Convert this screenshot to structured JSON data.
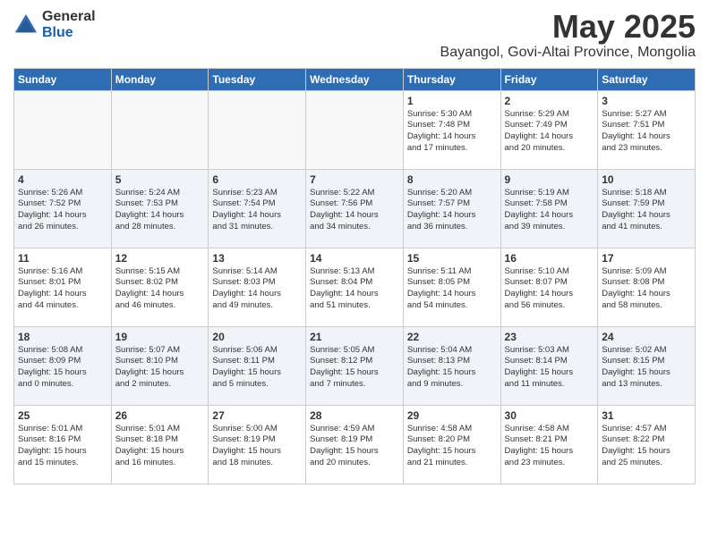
{
  "logo": {
    "general": "General",
    "blue": "Blue"
  },
  "title": "May 2025",
  "location": "Bayangol, Govi-Altai Province, Mongolia",
  "days_header": [
    "Sunday",
    "Monday",
    "Tuesday",
    "Wednesday",
    "Thursday",
    "Friday",
    "Saturday"
  ],
  "weeks": [
    {
      "row_class": "row-odd",
      "days": [
        {
          "num": "",
          "info": ""
        },
        {
          "num": "",
          "info": ""
        },
        {
          "num": "",
          "info": ""
        },
        {
          "num": "",
          "info": ""
        },
        {
          "num": "1",
          "info": "Sunrise: 5:30 AM\nSunset: 7:48 PM\nDaylight: 14 hours\nand 17 minutes."
        },
        {
          "num": "2",
          "info": "Sunrise: 5:29 AM\nSunset: 7:49 PM\nDaylight: 14 hours\nand 20 minutes."
        },
        {
          "num": "3",
          "info": "Sunrise: 5:27 AM\nSunset: 7:51 PM\nDaylight: 14 hours\nand 23 minutes."
        }
      ]
    },
    {
      "row_class": "row-even",
      "days": [
        {
          "num": "4",
          "info": "Sunrise: 5:26 AM\nSunset: 7:52 PM\nDaylight: 14 hours\nand 26 minutes."
        },
        {
          "num": "5",
          "info": "Sunrise: 5:24 AM\nSunset: 7:53 PM\nDaylight: 14 hours\nand 28 minutes."
        },
        {
          "num": "6",
          "info": "Sunrise: 5:23 AM\nSunset: 7:54 PM\nDaylight: 14 hours\nand 31 minutes."
        },
        {
          "num": "7",
          "info": "Sunrise: 5:22 AM\nSunset: 7:56 PM\nDaylight: 14 hours\nand 34 minutes."
        },
        {
          "num": "8",
          "info": "Sunrise: 5:20 AM\nSunset: 7:57 PM\nDaylight: 14 hours\nand 36 minutes."
        },
        {
          "num": "9",
          "info": "Sunrise: 5:19 AM\nSunset: 7:58 PM\nDaylight: 14 hours\nand 39 minutes."
        },
        {
          "num": "10",
          "info": "Sunrise: 5:18 AM\nSunset: 7:59 PM\nDaylight: 14 hours\nand 41 minutes."
        }
      ]
    },
    {
      "row_class": "row-odd",
      "days": [
        {
          "num": "11",
          "info": "Sunrise: 5:16 AM\nSunset: 8:01 PM\nDaylight: 14 hours\nand 44 minutes."
        },
        {
          "num": "12",
          "info": "Sunrise: 5:15 AM\nSunset: 8:02 PM\nDaylight: 14 hours\nand 46 minutes."
        },
        {
          "num": "13",
          "info": "Sunrise: 5:14 AM\nSunset: 8:03 PM\nDaylight: 14 hours\nand 49 minutes."
        },
        {
          "num": "14",
          "info": "Sunrise: 5:13 AM\nSunset: 8:04 PM\nDaylight: 14 hours\nand 51 minutes."
        },
        {
          "num": "15",
          "info": "Sunrise: 5:11 AM\nSunset: 8:05 PM\nDaylight: 14 hours\nand 54 minutes."
        },
        {
          "num": "16",
          "info": "Sunrise: 5:10 AM\nSunset: 8:07 PM\nDaylight: 14 hours\nand 56 minutes."
        },
        {
          "num": "17",
          "info": "Sunrise: 5:09 AM\nSunset: 8:08 PM\nDaylight: 14 hours\nand 58 minutes."
        }
      ]
    },
    {
      "row_class": "row-even",
      "days": [
        {
          "num": "18",
          "info": "Sunrise: 5:08 AM\nSunset: 8:09 PM\nDaylight: 15 hours\nand 0 minutes."
        },
        {
          "num": "19",
          "info": "Sunrise: 5:07 AM\nSunset: 8:10 PM\nDaylight: 15 hours\nand 2 minutes."
        },
        {
          "num": "20",
          "info": "Sunrise: 5:06 AM\nSunset: 8:11 PM\nDaylight: 15 hours\nand 5 minutes."
        },
        {
          "num": "21",
          "info": "Sunrise: 5:05 AM\nSunset: 8:12 PM\nDaylight: 15 hours\nand 7 minutes."
        },
        {
          "num": "22",
          "info": "Sunrise: 5:04 AM\nSunset: 8:13 PM\nDaylight: 15 hours\nand 9 minutes."
        },
        {
          "num": "23",
          "info": "Sunrise: 5:03 AM\nSunset: 8:14 PM\nDaylight: 15 hours\nand 11 minutes."
        },
        {
          "num": "24",
          "info": "Sunrise: 5:02 AM\nSunset: 8:15 PM\nDaylight: 15 hours\nand 13 minutes."
        }
      ]
    },
    {
      "row_class": "row-odd",
      "days": [
        {
          "num": "25",
          "info": "Sunrise: 5:01 AM\nSunset: 8:16 PM\nDaylight: 15 hours\nand 15 minutes."
        },
        {
          "num": "26",
          "info": "Sunrise: 5:01 AM\nSunset: 8:18 PM\nDaylight: 15 hours\nand 16 minutes."
        },
        {
          "num": "27",
          "info": "Sunrise: 5:00 AM\nSunset: 8:19 PM\nDaylight: 15 hours\nand 18 minutes."
        },
        {
          "num": "28",
          "info": "Sunrise: 4:59 AM\nSunset: 8:19 PM\nDaylight: 15 hours\nand 20 minutes."
        },
        {
          "num": "29",
          "info": "Sunrise: 4:58 AM\nSunset: 8:20 PM\nDaylight: 15 hours\nand 21 minutes."
        },
        {
          "num": "30",
          "info": "Sunrise: 4:58 AM\nSunset: 8:21 PM\nDaylight: 15 hours\nand 23 minutes."
        },
        {
          "num": "31",
          "info": "Sunrise: 4:57 AM\nSunset: 8:22 PM\nDaylight: 15 hours\nand 25 minutes."
        }
      ]
    }
  ]
}
